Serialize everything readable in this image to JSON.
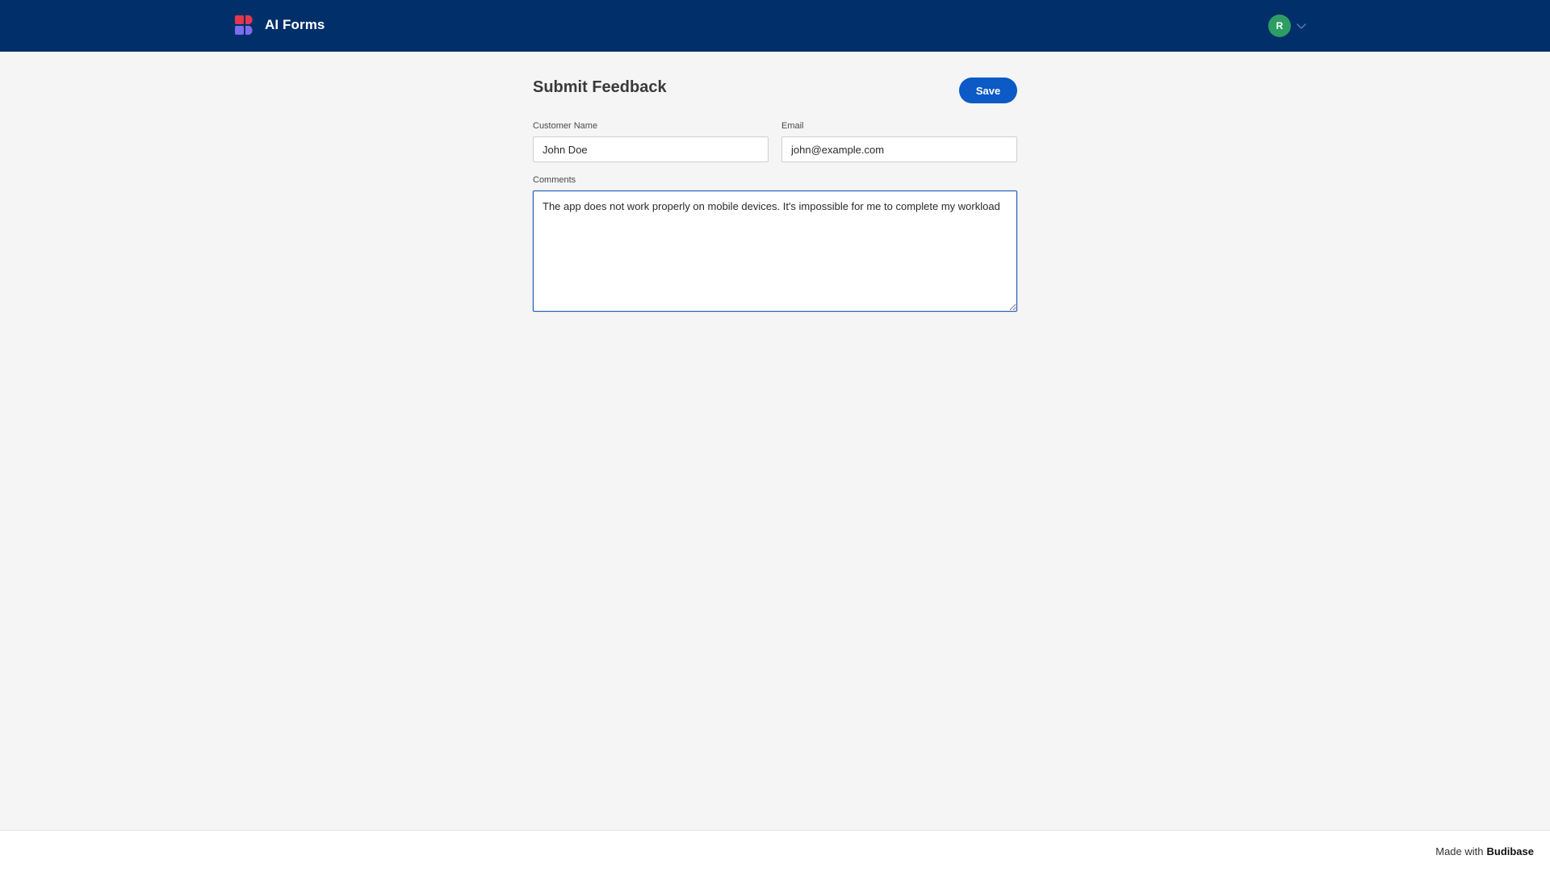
{
  "app": {
    "title": "AI Forms",
    "logo_icon": "budibase-logo-icon",
    "colors": {
      "topbar": "#012f6a",
      "accent": "#0b5ac5",
      "avatar": "#2e9d63",
      "logo_red": "#e5374b",
      "logo_purple": "#7b6cf0"
    }
  },
  "user": {
    "initial": "R",
    "menu_icon": "chevron-down-icon"
  },
  "form": {
    "title": "Submit Feedback",
    "save_label": "Save",
    "fields": {
      "customer_name": {
        "label": "Customer Name",
        "value": "John Doe"
      },
      "email": {
        "label": "Email",
        "value": "john@example.com"
      },
      "comments": {
        "label": "Comments",
        "value": "The app does not work properly on mobile devices. It's impossible for me to complete my workload"
      }
    }
  },
  "footer": {
    "prefix": "Made with",
    "brand": "Budibase"
  }
}
